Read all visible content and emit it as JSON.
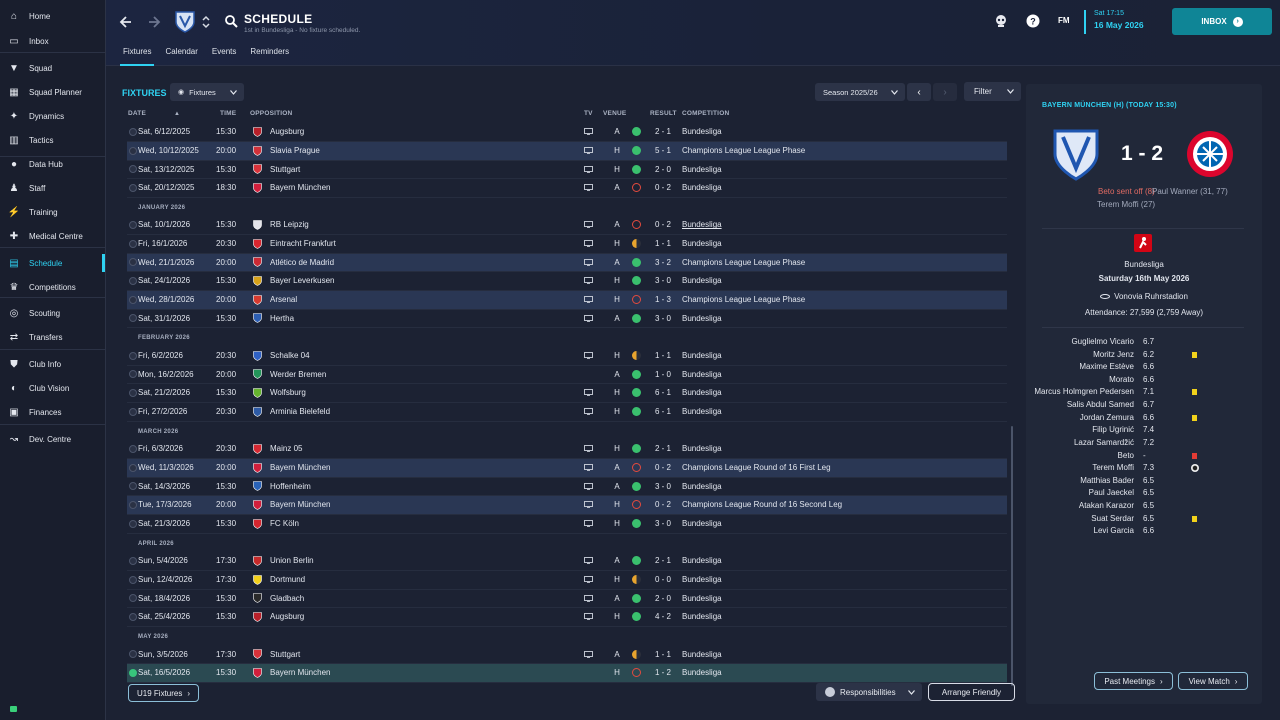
{
  "sidebar": {
    "items": [
      {
        "label": "Home",
        "icon": "home-icon"
      },
      {
        "label": "Inbox",
        "icon": "inbox-icon"
      },
      {
        "label": "Squad",
        "icon": "shirt-icon"
      },
      {
        "label": "Squad Planner",
        "icon": "planner-icon"
      },
      {
        "label": "Dynamics",
        "icon": "dynamics-icon"
      },
      {
        "label": "Tactics",
        "icon": "tactics-icon"
      },
      {
        "label": "Data Hub",
        "icon": "data-hub-icon"
      },
      {
        "label": "Staff",
        "icon": "staff-icon"
      },
      {
        "label": "Training",
        "icon": "training-icon"
      },
      {
        "label": "Medical Centre",
        "icon": "medical-icon"
      },
      {
        "label": "Schedule",
        "icon": "calendar-icon"
      },
      {
        "label": "Competitions",
        "icon": "trophy-icon"
      },
      {
        "label": "Scouting",
        "icon": "scouting-icon"
      },
      {
        "label": "Transfers",
        "icon": "transfers-icon"
      },
      {
        "label": "Club Info",
        "icon": "shield-icon"
      },
      {
        "label": "Club Vision",
        "icon": "vision-icon"
      },
      {
        "label": "Finances",
        "icon": "finances-icon"
      },
      {
        "label": "Dev. Centre",
        "icon": "dev-centre-icon"
      }
    ]
  },
  "header": {
    "title": "SCHEDULE",
    "subtitle": "1st in Bundesliga - No fixture scheduled.",
    "tabs": [
      "Fixtures",
      "Calendar",
      "Events",
      "Reminders"
    ],
    "fm": "FM",
    "date_day": "Sat 17:15",
    "date_full": "16 May 2026",
    "inbox": "INBOX",
    "accent": "#2fd2f2"
  },
  "toolbar": {
    "section_label": "FIXTURES",
    "view_dropdown": "Fixtures",
    "season": "Season 2025/26",
    "filter": "Filter"
  },
  "columns": {
    "date": "DATE",
    "time": "TIME",
    "opposition": "OPPOSITION",
    "tv": "TV",
    "venue": "VENUE",
    "result": "RESULT",
    "competition": "COMPETITION"
  },
  "fixtures": [
    {
      "kind": "row",
      "date": "Sat, 6/12/2025",
      "time": "15:30",
      "opp": "Augsburg",
      "tv": true,
      "venue": "A",
      "res": "W",
      "score": "2 - 1",
      "comp": "Bundesliga",
      "badge": "#b8202a"
    },
    {
      "kind": "row",
      "date": "Wed, 10/12/2025",
      "time": "20:00",
      "opp": "Slavia Prague",
      "tv": true,
      "venue": "H",
      "res": "W",
      "score": "5 - 1",
      "comp": "Champions League League Phase",
      "hl": true,
      "badge": "#d0313a"
    },
    {
      "kind": "row",
      "date": "Sat, 13/12/2025",
      "time": "15:30",
      "opp": "Stuttgart",
      "tv": true,
      "venue": "H",
      "res": "W",
      "score": "2 - 0",
      "comp": "Bundesliga",
      "badge": "#d8323a"
    },
    {
      "kind": "row",
      "date": "Sat, 20/12/2025",
      "time": "18:30",
      "opp": "Bayern München",
      "tv": true,
      "venue": "A",
      "res": "L",
      "score": "0 - 2",
      "comp": "Bundesliga",
      "badge": "#d21f3c"
    },
    {
      "kind": "month",
      "label": "JANUARY 2026"
    },
    {
      "kind": "row",
      "date": "Sat, 10/1/2026",
      "time": "15:30",
      "opp": "RB Leipzig",
      "tv": true,
      "venue": "A",
      "res": "L",
      "score": "0 - 2",
      "comp": "Bundesliga",
      "ul": true,
      "badge": "#e4e4ea"
    },
    {
      "kind": "row",
      "date": "Fri, 16/1/2026",
      "time": "20:30",
      "opp": "Eintracht Frankfurt",
      "tv": true,
      "venue": "H",
      "res": "D",
      "score": "1 - 1",
      "comp": "Bundesliga",
      "badge": "#d9262f"
    },
    {
      "kind": "row",
      "date": "Wed, 21/1/2026",
      "time": "20:00",
      "opp": "Atlético de Madrid",
      "tv": true,
      "venue": "A",
      "res": "W",
      "score": "3 - 2",
      "comp": "Champions League League Phase",
      "hl": true,
      "badge": "#cb2a35"
    },
    {
      "kind": "row",
      "date": "Sat, 24/1/2026",
      "time": "15:30",
      "opp": "Bayer Leverkusen",
      "tv": true,
      "venue": "H",
      "res": "W",
      "score": "3 - 0",
      "comp": "Bundesliga",
      "badge": "#d7a21a"
    },
    {
      "kind": "row",
      "date": "Wed, 28/1/2026",
      "time": "20:00",
      "opp": "Arsenal",
      "tv": true,
      "venue": "H",
      "res": "L",
      "score": "1 - 3",
      "comp": "Champions League League Phase",
      "hl": true,
      "badge": "#d63a2f"
    },
    {
      "kind": "row",
      "date": "Sat, 31/1/2026",
      "time": "15:30",
      "opp": "Hertha",
      "tv": true,
      "venue": "A",
      "res": "W",
      "score": "3 - 0",
      "comp": "Bundesliga",
      "badge": "#2d5fb4"
    },
    {
      "kind": "month",
      "label": "FEBRUARY 2026"
    },
    {
      "kind": "row",
      "date": "Fri, 6/2/2026",
      "time": "20:30",
      "opp": "Schalke 04",
      "tv": true,
      "venue": "H",
      "res": "D",
      "score": "1 - 1",
      "comp": "Bundesliga",
      "badge": "#2f61c4"
    },
    {
      "kind": "row",
      "date": "Mon, 16/2/2026",
      "time": "20:00",
      "opp": "Werder Bremen",
      "tv": false,
      "venue": "A",
      "res": "W",
      "score": "1 - 0",
      "comp": "Bundesliga",
      "badge": "#23955a"
    },
    {
      "kind": "row",
      "date": "Sat, 21/2/2026",
      "time": "15:30",
      "opp": "Wolfsburg",
      "tv": true,
      "venue": "H",
      "res": "W",
      "score": "6 - 1",
      "comp": "Bundesliga",
      "badge": "#65b32e"
    },
    {
      "kind": "row",
      "date": "Fri, 27/2/2026",
      "time": "20:30",
      "opp": "Arminia Bielefeld",
      "tv": true,
      "venue": "H",
      "res": "W",
      "score": "6 - 1",
      "comp": "Bundesliga",
      "badge": "#2e5ba6"
    },
    {
      "kind": "month",
      "label": "MARCH 2026"
    },
    {
      "kind": "row",
      "date": "Fri, 6/3/2026",
      "time": "20:30",
      "opp": "Mainz 05",
      "tv": true,
      "venue": "H",
      "res": "W",
      "score": "2 - 1",
      "comp": "Bundesliga",
      "badge": "#d52832"
    },
    {
      "kind": "row",
      "date": "Wed, 11/3/2026",
      "time": "20:00",
      "opp": "Bayern München",
      "tv": true,
      "venue": "A",
      "res": "L",
      "score": "0 - 2",
      "comp": "Champions League Round of 16  First Leg",
      "hl": true,
      "badge": "#d21f3c"
    },
    {
      "kind": "row",
      "date": "Sat, 14/3/2026",
      "time": "15:30",
      "opp": "Hoffenheim",
      "tv": true,
      "venue": "A",
      "res": "W",
      "score": "3 - 0",
      "comp": "Bundesliga",
      "badge": "#2a63b8"
    },
    {
      "kind": "row",
      "date": "Tue, 17/3/2026",
      "time": "20:00",
      "opp": "Bayern München",
      "tv": true,
      "venue": "H",
      "res": "L",
      "score": "0 - 2",
      "comp": "Champions League Round of 16  Second Leg",
      "hl": true,
      "badge": "#d21f3c"
    },
    {
      "kind": "row",
      "date": "Sat, 21/3/2026",
      "time": "15:30",
      "opp": "FC Köln",
      "tv": true,
      "venue": "H",
      "res": "W",
      "score": "3 - 0",
      "comp": "Bundesliga",
      "badge": "#d5262f"
    },
    {
      "kind": "month",
      "label": "APRIL 2026"
    },
    {
      "kind": "row",
      "date": "Sun, 5/4/2026",
      "time": "17:30",
      "opp": "Union Berlin",
      "tv": true,
      "venue": "A",
      "res": "W",
      "score": "2 - 1",
      "comp": "Bundesliga",
      "badge": "#c62a2a"
    },
    {
      "kind": "row",
      "date": "Sun, 12/4/2026",
      "time": "17:30",
      "opp": "Dortmund",
      "tv": true,
      "venue": "H",
      "res": "D",
      "score": "0 - 0",
      "comp": "Bundesliga",
      "badge": "#f2d01b"
    },
    {
      "kind": "row",
      "date": "Sat, 18/4/2026",
      "time": "15:30",
      "opp": "Gladbach",
      "tv": true,
      "venue": "A",
      "res": "W",
      "score": "2 - 0",
      "comp": "Bundesliga",
      "badge": "#2a2a2a"
    },
    {
      "kind": "row",
      "date": "Sat, 25/4/2026",
      "time": "15:30",
      "opp": "Augsburg",
      "tv": true,
      "venue": "H",
      "res": "W",
      "score": "4 - 2",
      "comp": "Bundesliga",
      "badge": "#b8202a"
    },
    {
      "kind": "month",
      "label": "MAY 2026"
    },
    {
      "kind": "row",
      "date": "Sun, 3/5/2026",
      "time": "17:30",
      "opp": "Stuttgart",
      "tv": true,
      "venue": "A",
      "res": "D",
      "score": "1 - 1",
      "comp": "Bundesliga",
      "badge": "#d8323a"
    },
    {
      "kind": "row",
      "date": "Sat, 16/5/2026",
      "time": "15:30",
      "opp": "Bayern München",
      "tv": false,
      "venue": "H",
      "res": "L",
      "score": "1 - 2",
      "comp": "Bundesliga",
      "sel": true,
      "badge": "#d21f3c"
    }
  ],
  "footer": {
    "u19": "U19 Fixtures",
    "responsibilities": "Responsibilities",
    "arrange": "Arrange Friendly"
  },
  "match": {
    "title": "BAYERN MÜNCHEN (H) (TODAY 15:30)",
    "score": "1 - 2",
    "home_event_1": "Beto sent off (8)",
    "home_event_2": "Terem Moffi (27)",
    "away_event": "Paul Wanner (31, 77)",
    "competition": "Bundesliga",
    "date": "Saturday 16th May 2026",
    "stadium": "Vonovia Ruhrstadion",
    "attendance": "Attendance: 27,599 (2,759 Away)",
    "players": [
      {
        "name": "Guglielmo Vicario",
        "rating": "6.7",
        "mark": ""
      },
      {
        "name": "Moritz Jenz",
        "rating": "6.2",
        "mark": "yellow"
      },
      {
        "name": "Maxime Estève",
        "rating": "6.6",
        "mark": ""
      },
      {
        "name": "Morato",
        "rating": "6.6",
        "mark": ""
      },
      {
        "name": "Marcus Holmgren Pedersen",
        "rating": "7.1",
        "mark": "yellow"
      },
      {
        "name": "Salis Abdul Samed",
        "rating": "6.7",
        "mark": ""
      },
      {
        "name": "Jordan Zemura",
        "rating": "6.6",
        "mark": "yellow"
      },
      {
        "name": "Filip Ugrinić",
        "rating": "7.4",
        "mark": ""
      },
      {
        "name": "Lazar Samardžić",
        "rating": "7.2",
        "mark": ""
      },
      {
        "name": "Beto",
        "rating": "-",
        "mark": "red"
      },
      {
        "name": "Terem Moffi",
        "rating": "7.3",
        "mark": "goal"
      },
      {
        "name": "Matthias Bader",
        "rating": "6.5",
        "mark": ""
      },
      {
        "name": "Paul Jaeckel",
        "rating": "6.5",
        "mark": ""
      },
      {
        "name": "Atakan Karazor",
        "rating": "6.5",
        "mark": ""
      },
      {
        "name": "Suat Serdar",
        "rating": "6.5",
        "mark": "yellow"
      },
      {
        "name": "Levi Garcia",
        "rating": "6.6",
        "mark": ""
      }
    ],
    "past_meetings": "Past Meetings",
    "view_match": "View Match"
  }
}
